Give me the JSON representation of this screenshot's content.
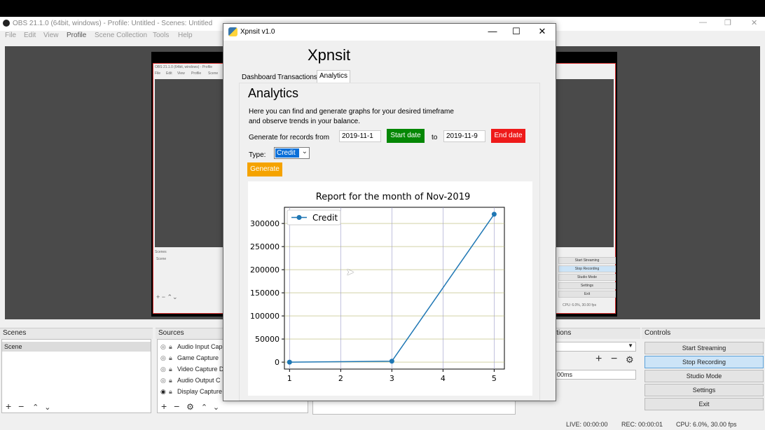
{
  "obs": {
    "title": "OBS 21.1.0 (64bit, windows) - Profile: Untitled - Scenes: Untitled",
    "menu": [
      "File",
      "Edit",
      "View",
      "Profile",
      "Scene Collection",
      "Tools",
      "Help"
    ],
    "window_controls": [
      "—",
      "❐",
      "✕"
    ],
    "nested_title": "OBS 21.1.0 (64bit, windows) - Profile",
    "nested_menu": [
      "File",
      "Edit",
      "View",
      "Profile",
      "Scene"
    ],
    "nested_scenes_label": "Scenes",
    "nested_scene_item": "Scene",
    "nested_buttons": [
      "Start Streaming",
      "Stop Recording",
      "Studio Mode",
      "Settings",
      "Exit"
    ],
    "nested_status": "CPU: 6.0%, 30.00 fps",
    "docks": {
      "scenes_title": "Scenes",
      "scene_item": "Scene",
      "sources_title": "Sources",
      "sources": [
        "Audio Input Cap",
        "Game Capture",
        "Video Capture D",
        "Audio Output C",
        "Display Capture"
      ],
      "transitions_title": "itions",
      "transition_duration": "00ms",
      "controls_title": "Controls",
      "controls": [
        "Start Streaming",
        "Stop Recording",
        "Studio Mode",
        "Settings",
        "Exit"
      ]
    },
    "status": {
      "live": "LIVE: 00:00:00",
      "rec": "REC: 00:00:01",
      "cpu": "CPU: 6.0%, 30.00 fps"
    }
  },
  "xpnsit": {
    "window_title": "Xpnsit v1.0",
    "app_title": "Xpnsit",
    "tabs": [
      "Dashboard",
      "Transactions",
      "Analytics"
    ],
    "active_tab": "Analytics",
    "heading": "Analytics",
    "description_line1": "Here you can find and generate graphs for your desired timeframe",
    "description_line2": "and observe trends in your balance.",
    "generate_label": "Generate for records from",
    "start_date_value": "2019-11-1",
    "start_date_button": "Start date",
    "to_label": "to",
    "end_date_value": "2019-11-9",
    "end_date_button": "End date",
    "type_label": "Type:",
    "type_value": "Credit",
    "generate_button": "Generate",
    "colors": {
      "start_button": "#058705",
      "end_button": "#ee1a1a",
      "generate_button": "#f5a300",
      "line": "#1f77b4"
    }
  },
  "chart_data": {
    "type": "line",
    "title": "Report for the month of Nov-2019",
    "xlabel": "",
    "ylabel": "",
    "x": [
      1,
      3,
      5
    ],
    "series": [
      {
        "name": "Credit",
        "values": [
          0,
          2000,
          320000
        ]
      }
    ],
    "xticks": [
      "1",
      "2",
      "3",
      "4",
      "5"
    ],
    "yticks": [
      "0",
      "50000",
      "100000",
      "150000",
      "200000",
      "250000",
      "300000"
    ],
    "xlim": [
      0.9,
      5.2
    ],
    "ylim": [
      -15000,
      335000
    ],
    "grid": true,
    "legend": "top-left"
  }
}
